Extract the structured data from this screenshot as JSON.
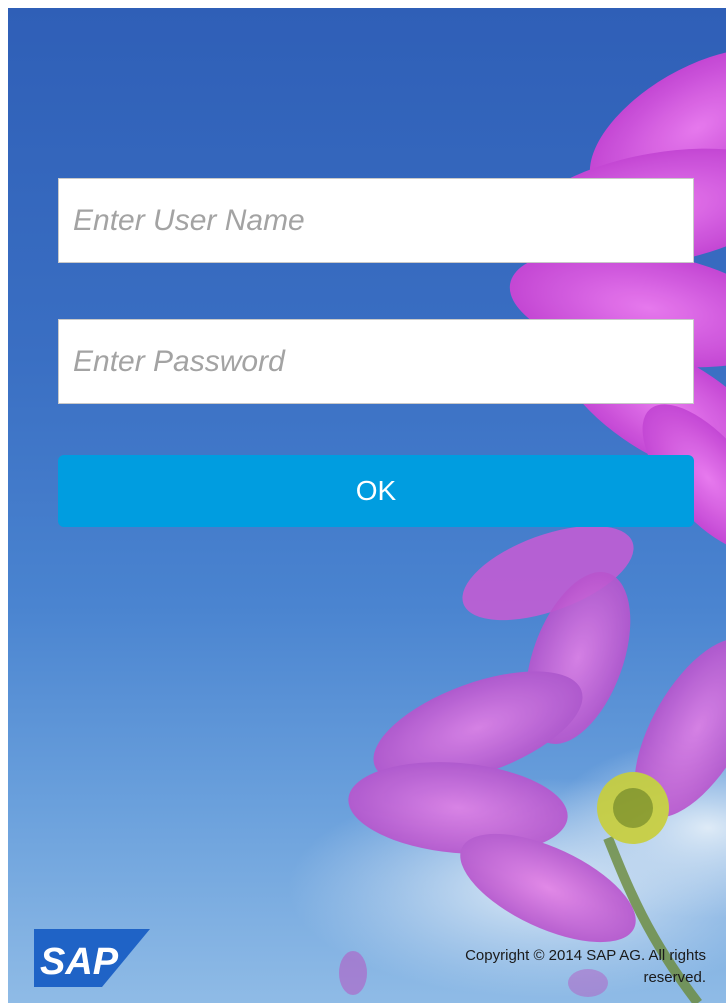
{
  "login": {
    "username_placeholder": "Enter User Name",
    "password_placeholder": "Enter Password",
    "ok_label": "OK"
  },
  "footer": {
    "logo_text": "SAP",
    "copyright": "Copyright © 2014 SAP AG. All rights reserved."
  },
  "colors": {
    "background_sky": "#3a6fc3",
    "button": "#009de0",
    "flower": "#d04fd8",
    "logo": "#1f63c6"
  }
}
